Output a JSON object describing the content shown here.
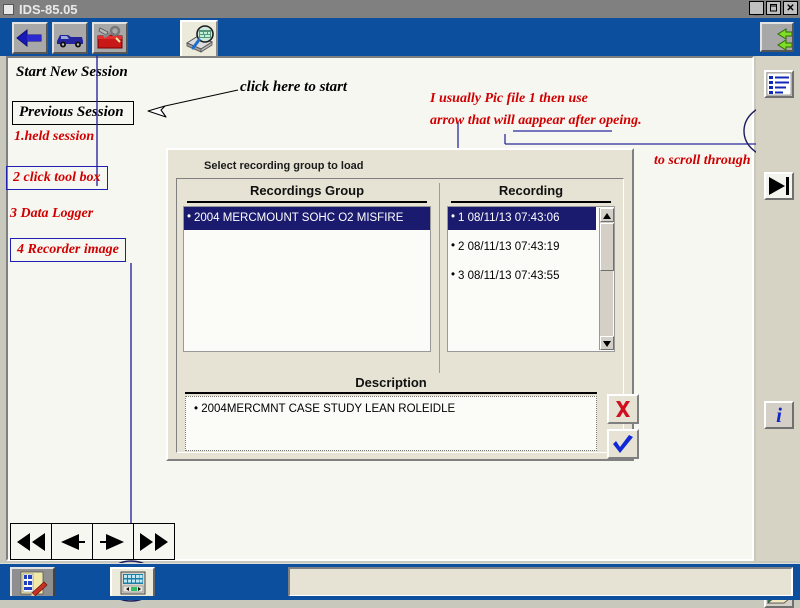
{
  "window": {
    "title": "IDS-85.05",
    "icon": "window-icon",
    "controls": {
      "minimize": "_",
      "restore": "❐",
      "close": "×"
    }
  },
  "toolbar": {
    "buttons": [
      {
        "name": "back-arrow-button",
        "icon": "back-arrow-icon",
        "label": "Back"
      },
      {
        "name": "vehicle-button",
        "icon": "vehicle-icon",
        "label": "Vehicle"
      },
      {
        "name": "toolbox-button",
        "icon": "toolbox-icon",
        "label": "Tool Box"
      }
    ],
    "selected_tab": {
      "name": "data-logger-tab",
      "icon": "magnifier-recorder-icon",
      "label": "Data Logger"
    },
    "right_button": {
      "name": "exchange-button",
      "icon": "green-exchange-arrows-icon",
      "label": "Swap"
    }
  },
  "session": {
    "start_new": "Start New Session",
    "previous": "Previous Session"
  },
  "annotations": [
    {
      "id": "a1",
      "text": "click here to start",
      "color": "#000000",
      "style": "black-script"
    },
    {
      "id": "a2",
      "text": "1.held session",
      "color": "#d00000",
      "style": "red-script"
    },
    {
      "id": "a3",
      "text": "2 click tool box",
      "color": "#d00000",
      "style": "red-script-boxed"
    },
    {
      "id": "a4",
      "text": "3 Data Logger",
      "color": "#d00000",
      "style": "red-script"
    },
    {
      "id": "a5",
      "text": "4 Recorder image",
      "color": "#d00000",
      "style": "red-script-boxed"
    },
    {
      "id": "a6_line1",
      "text": "I usually Pic file 1 then use",
      "color": "#d00000",
      "style": "red-script"
    },
    {
      "id": "a6_line2",
      "text": "arrow that will aappear after opeing.",
      "color": "#d00000",
      "style": "red-script"
    },
    {
      "id": "a7",
      "text": "to scroll through",
      "color": "#d00000",
      "style": "red-script"
    }
  ],
  "dialog": {
    "title": "Select recording group to load",
    "columns": {
      "group_header": "Recordings Group",
      "recording_header": "Recording"
    },
    "recording_groups": [
      {
        "text": "2004 MERCMOUNT SOHC O2 MISFIRE",
        "selected": true
      }
    ],
    "recordings": [
      {
        "text": "1   08/11/13 07:43:06",
        "selected": true
      },
      {
        "text": "2   08/11/13 07:43:19",
        "selected": false
      },
      {
        "text": "3   08/11/13 07:43:55",
        "selected": false
      }
    ],
    "description_header": "Description",
    "description_items": [
      "2004MERCMNT CASE STUDY LEAN ROLEIDLE"
    ],
    "buttons": [
      {
        "name": "cancel-button",
        "icon": "red-x-icon",
        "label": "Cancel"
      },
      {
        "name": "confirm-button",
        "icon": "blue-check-icon",
        "label": "OK"
      }
    ],
    "scrollbar": {
      "up": "▲",
      "down": "▼"
    }
  },
  "bottom_nav": [
    {
      "name": "nav-first-button",
      "icon": "rewind-double-left-icon",
      "label": "First"
    },
    {
      "name": "nav-prev-button",
      "icon": "prev-left-icon",
      "label": "Previous"
    },
    {
      "name": "nav-next-button",
      "icon": "next-right-icon",
      "label": "Next"
    },
    {
      "name": "nav-last-button",
      "icon": "forward-double-right-icon",
      "label": "Last"
    }
  ],
  "right_sidebar": [
    {
      "name": "sidebar-list-button",
      "icon": "list-lines-icon",
      "label": "List"
    },
    {
      "name": "sidebar-next-button",
      "icon": "skip-to-end-icon",
      "label": "Skip To End",
      "circled": true
    },
    {
      "name": "sidebar-info-button",
      "icon": "info-i-icon",
      "label": "Information"
    },
    {
      "name": "sidebar-library-button",
      "icon": "books-icon",
      "label": "Library"
    }
  ],
  "taskbar": {
    "items": [
      {
        "name": "taskbar-start-button",
        "icon": "notepad-pencil-icon",
        "label": "Start"
      },
      {
        "name": "taskbar-ids-window",
        "icon": "ids-window-icon",
        "label": "IDS",
        "circled": true
      }
    ],
    "tray_field": ""
  },
  "colors": {
    "toolbar_blue": "#0b4f9e",
    "title_gray": "#808080",
    "panel_bg": "#f7f7f2",
    "dialog_bg": "#e6e3d4",
    "selection_navy": "#1a1a6e",
    "annotation_red": "#d00000",
    "ink_blue": "#2a2a9c"
  }
}
